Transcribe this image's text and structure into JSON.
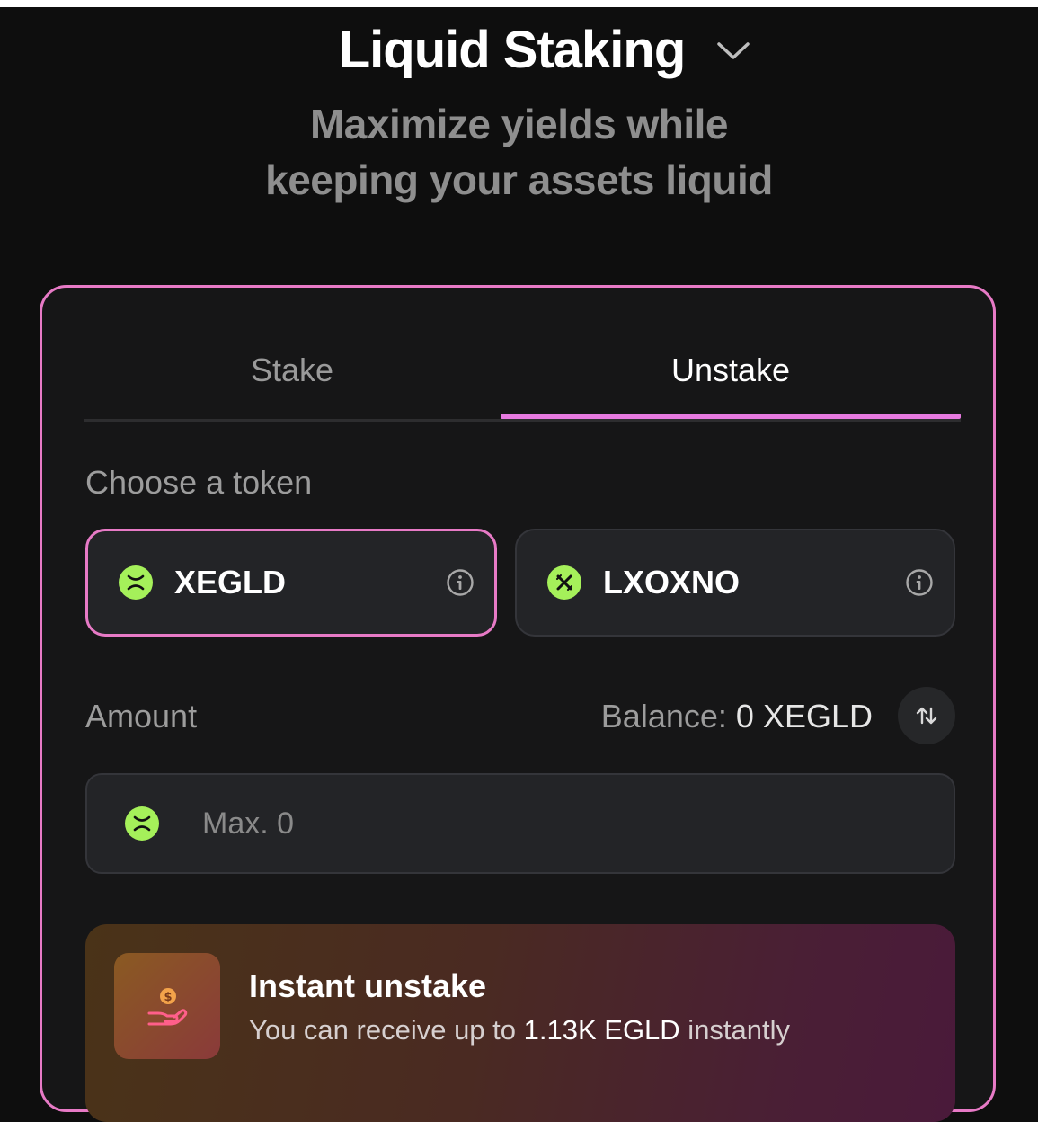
{
  "header": {
    "title": "Liquid Staking",
    "subtitle_line1": "Maximize yields while",
    "subtitle_line2": "keeping your assets liquid"
  },
  "tabs": [
    {
      "label": "Stake",
      "active": false
    },
    {
      "label": "Unstake",
      "active": true
    }
  ],
  "token_select": {
    "label": "Choose a token",
    "tokens": [
      {
        "name": "XEGLD",
        "icon": "xegld-token-icon",
        "selected": true
      },
      {
        "name": "LXOXNO",
        "icon": "lxoxno-token-icon",
        "selected": false
      }
    ]
  },
  "amount": {
    "label": "Amount",
    "balance_label": "Balance:",
    "balance_value": "0 XEGLD",
    "input_value": "",
    "placeholder": "Max. 0"
  },
  "instant_unstake": {
    "title": "Instant unstake",
    "desc_prefix": "You can receive up to ",
    "desc_amount": "1.13K EGLD",
    "desc_suffix": " instantly"
  },
  "colors": {
    "background": "#0e0e0e",
    "accent_pink": "#e77ac6",
    "token_green": "#a5f05a",
    "subtitle_gray": "#8e8e8e"
  }
}
